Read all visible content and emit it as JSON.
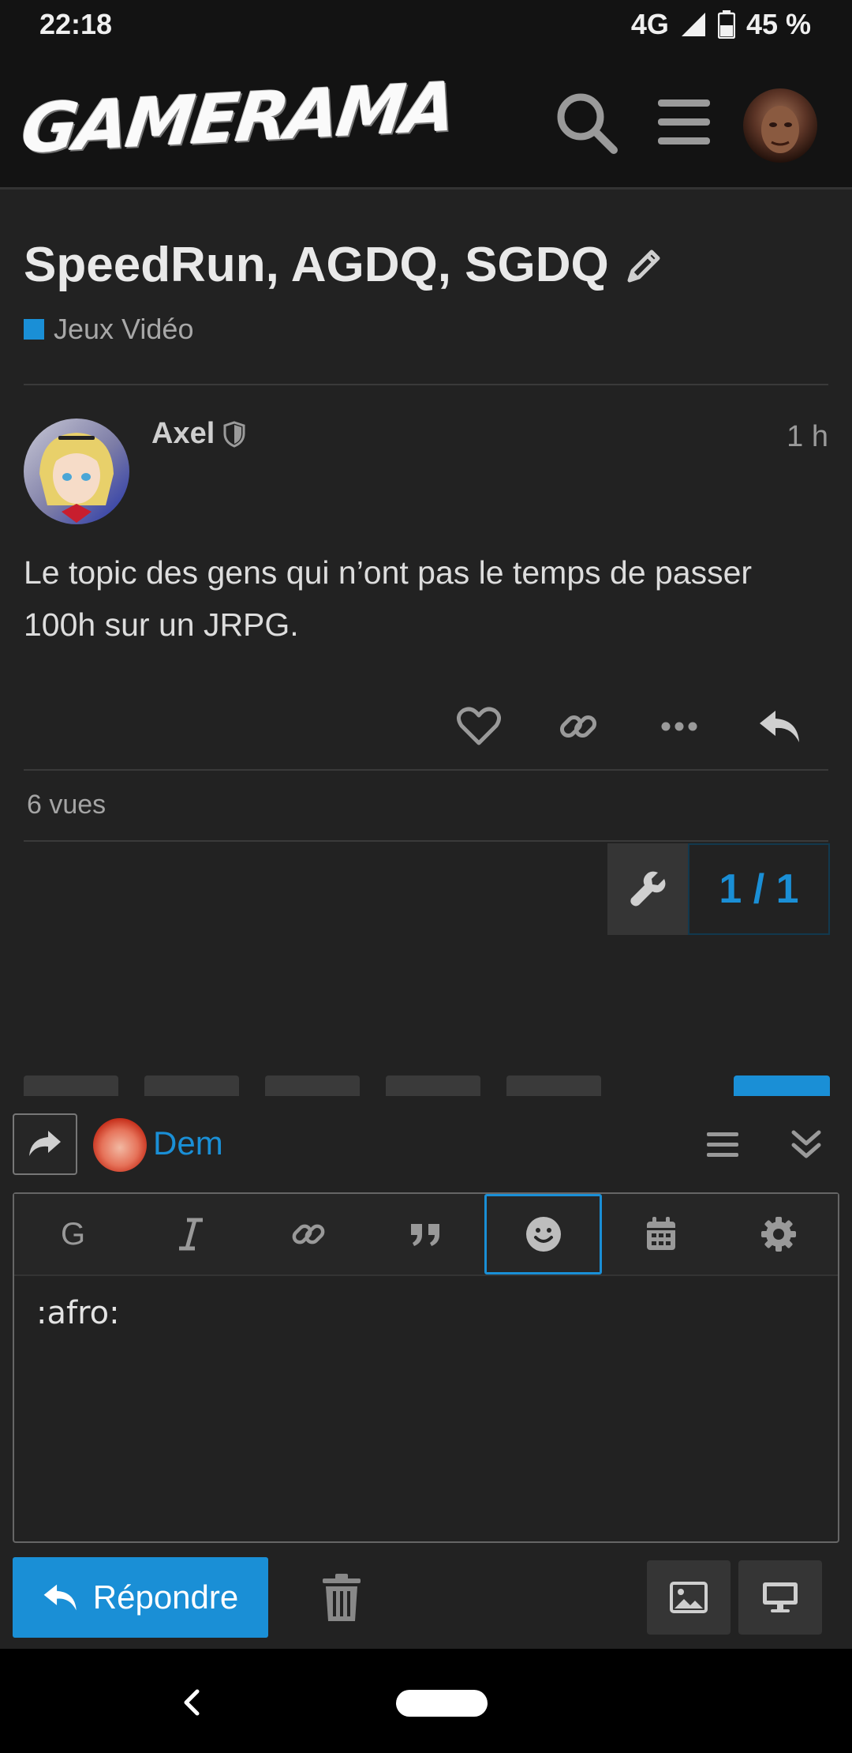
{
  "status_bar": {
    "time": "22:18",
    "network": "4G",
    "battery": "45 %"
  },
  "header": {
    "logo": "GAMERAMA"
  },
  "topic": {
    "title": "SpeedRun, AGDQ, SGDQ",
    "category": "Jeux Vidéo"
  },
  "post": {
    "username": "Axel",
    "time": "1 h",
    "body": "Le topic des gens qui n’ont pas le temps de passer 100h sur un JRPG."
  },
  "stats": {
    "views": "6 vues"
  },
  "progress": "1 / 1",
  "composer": {
    "user": "Dem",
    "toolbar": {
      "bold": "G"
    },
    "text": ":afro:",
    "reply_label": "Répondre"
  },
  "colors": {
    "accent": "#1a8fd6",
    "background": "#222222",
    "header": "#131313"
  }
}
